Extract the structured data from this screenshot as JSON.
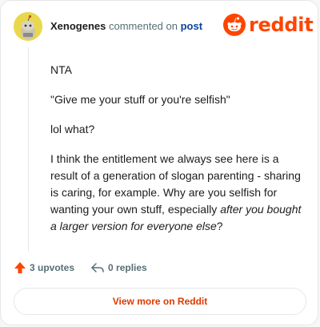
{
  "header": {
    "username": "Xenogenes",
    "action_text": "commented on",
    "post_link": "post",
    "logo_text": "reddit"
  },
  "comment": {
    "p1": "NTA",
    "p2": "\"Give me your stuff or you're selfish\"",
    "p3": "lol what?",
    "p4_plain": "I think the entitlement we always see here is a result of a generation of slogan parenting - sharing is caring, for example. Why are you selfish for wanting your own stuff, especially ",
    "p4_italic": "after you bought a larger version for everyone else",
    "p4_end": "?"
  },
  "actions": {
    "upvotes": "3 upvotes",
    "replies": "0 replies"
  },
  "footer": {
    "view_more": "View more on Reddit"
  },
  "colors": {
    "brand": "#ff4500",
    "link": "#0a449b",
    "muted": "#576f76"
  }
}
